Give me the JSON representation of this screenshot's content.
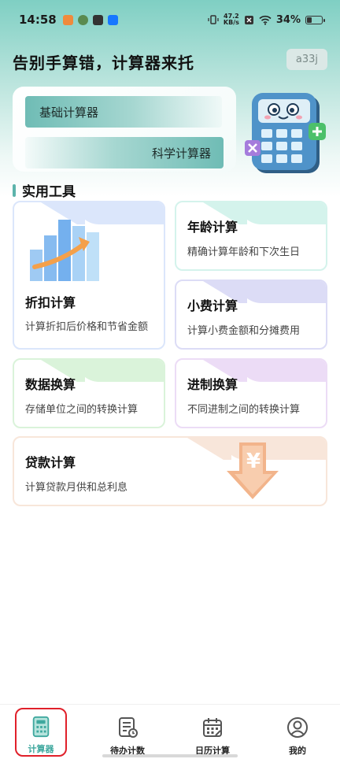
{
  "status_bar": {
    "time": "14:58",
    "net_speed_value": "47.2",
    "net_speed_unit": "KB/s",
    "battery_percent": "34%",
    "battery_level": 0.34
  },
  "header": {
    "headline": "告别手算错，计算器来托",
    "version_badge": "a33j"
  },
  "calculator_card": {
    "basic_label": "基础计算器",
    "scientific_label": "科学计算器"
  },
  "section": {
    "title": "实用工具"
  },
  "tools": {
    "discount": {
      "title": "折扣计算",
      "subtitle": "计算折扣后价格和节省金额",
      "color": "#dbe6fb"
    },
    "age": {
      "title": "年龄计算",
      "subtitle": "精确计算年龄和下次生日",
      "color": "#d4f3ec"
    },
    "tip": {
      "title": "小费计算",
      "subtitle": "计算小费金额和分摊费用",
      "color": "#dcdcf6"
    },
    "data": {
      "title": "数据换算",
      "subtitle": "存储单位之间的转换计算",
      "color": "#daf3da"
    },
    "base": {
      "title": "进制换算",
      "subtitle": "不同进制之间的转换计算",
      "color": "#ecdcf6"
    },
    "loan": {
      "title": "贷款计算",
      "subtitle": "计算贷款月供和总利息",
      "color": "#f8e6da"
    }
  },
  "bottom_nav": {
    "items": [
      {
        "label": "计算器",
        "icon": "calculator-icon",
        "active": true
      },
      {
        "label": "待办计数",
        "icon": "todo-icon",
        "active": false
      },
      {
        "label": "日历计算",
        "icon": "calendar-icon",
        "active": false
      },
      {
        "label": "我的",
        "icon": "profile-icon",
        "active": false
      }
    ]
  },
  "colors": {
    "accent": "#5cb3ab",
    "active_nav": "#3fa89e",
    "highlight": "#e0202a"
  }
}
